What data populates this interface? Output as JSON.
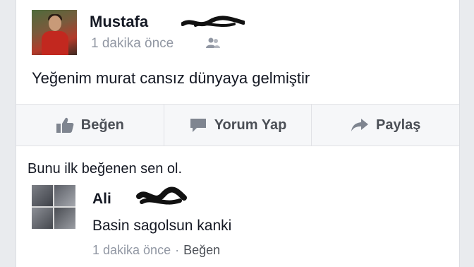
{
  "post": {
    "author": "Mustafa",
    "time": "1 dakika önce",
    "audience_icon": "friends-icon",
    "text": "Yeğenim murat cansız dünyaya gelmiştir"
  },
  "actions": {
    "like_label": "Beğen",
    "like_icon": "thumbs-up-icon",
    "comment_label": "Yorum Yap",
    "comment_icon": "speech-bubble-icon",
    "share_label": "Paylaş",
    "share_icon": "share-arrow-icon"
  },
  "likes": {
    "text": "Bunu ilk beğenen sen ol."
  },
  "comment": {
    "author": "Ali",
    "text": "Basin sagolsun kanki",
    "time": "1 dakika önce",
    "separator": "·",
    "like_label": "Beğen"
  },
  "colors": {
    "background": "#e9ebee",
    "text": "#141823",
    "secondary_text": "#9197a3",
    "action_text": "#4b4f56"
  }
}
